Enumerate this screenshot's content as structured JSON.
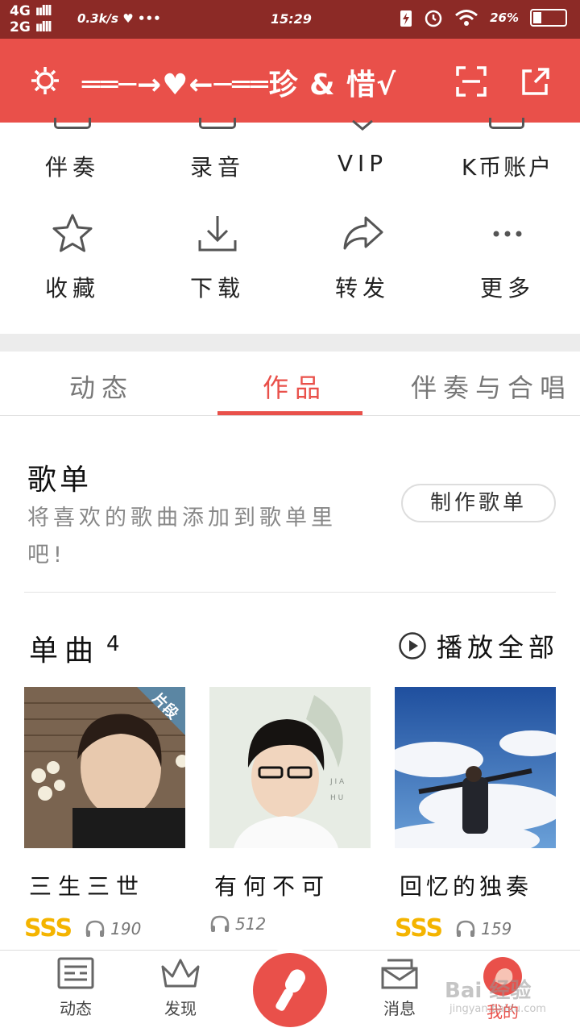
{
  "status": {
    "net_top": "4G",
    "net_bottom": "2G",
    "speed": "0.3k/s",
    "dots": "•••",
    "time": "15:29",
    "battery": "26%",
    "battery_level": 0.26
  },
  "header": {
    "title": "══─→♥←─══珍 & 惜√"
  },
  "actions": [
    {
      "label": "伴奏",
      "icon": "accompaniment-icon"
    },
    {
      "label": "录音",
      "icon": "record-icon"
    },
    {
      "label": "VIP",
      "icon": "vip-icon"
    },
    {
      "label": "K币账户",
      "icon": "kcoin-icon"
    },
    {
      "label": "收藏",
      "icon": "star-icon"
    },
    {
      "label": "下载",
      "icon": "download-icon"
    },
    {
      "label": "转发",
      "icon": "forward-icon"
    },
    {
      "label": "更多",
      "icon": "more-icon"
    }
  ],
  "tabs": [
    {
      "label": "动态",
      "active": false
    },
    {
      "label": "作品",
      "active": true
    },
    {
      "label": "伴奏与合唱",
      "active": false
    }
  ],
  "playlist": {
    "title": "歌单",
    "desc": "将喜欢的歌曲添加到歌单里吧!",
    "button": "制作歌单"
  },
  "singles": {
    "title": "单曲",
    "count": "4",
    "play_all": "播放全部",
    "items": [
      {
        "name": "三生三世",
        "badge": "片段",
        "grade": "SSS",
        "plays": "190"
      },
      {
        "name": "有何不可",
        "badge": "",
        "grade": "",
        "plays": "512"
      },
      {
        "name": "回忆的独奏",
        "badge": "",
        "grade": "SSS",
        "plays": "159"
      }
    ]
  },
  "tabbar": [
    {
      "label": "动态",
      "icon": "feed-icon"
    },
    {
      "label": "发现",
      "icon": "crown-icon"
    },
    {
      "label": "",
      "icon": "microphone-icon"
    },
    {
      "label": "消息",
      "icon": "message-icon"
    },
    {
      "label": "我的",
      "icon": "profile-icon"
    }
  ],
  "watermark": {
    "main": "Bai 经验",
    "sub": "jingyan.baidu.com"
  },
  "colors": {
    "accent": "#e9504a",
    "statusbar": "#8c2a26",
    "grade": "#f4b400"
  }
}
